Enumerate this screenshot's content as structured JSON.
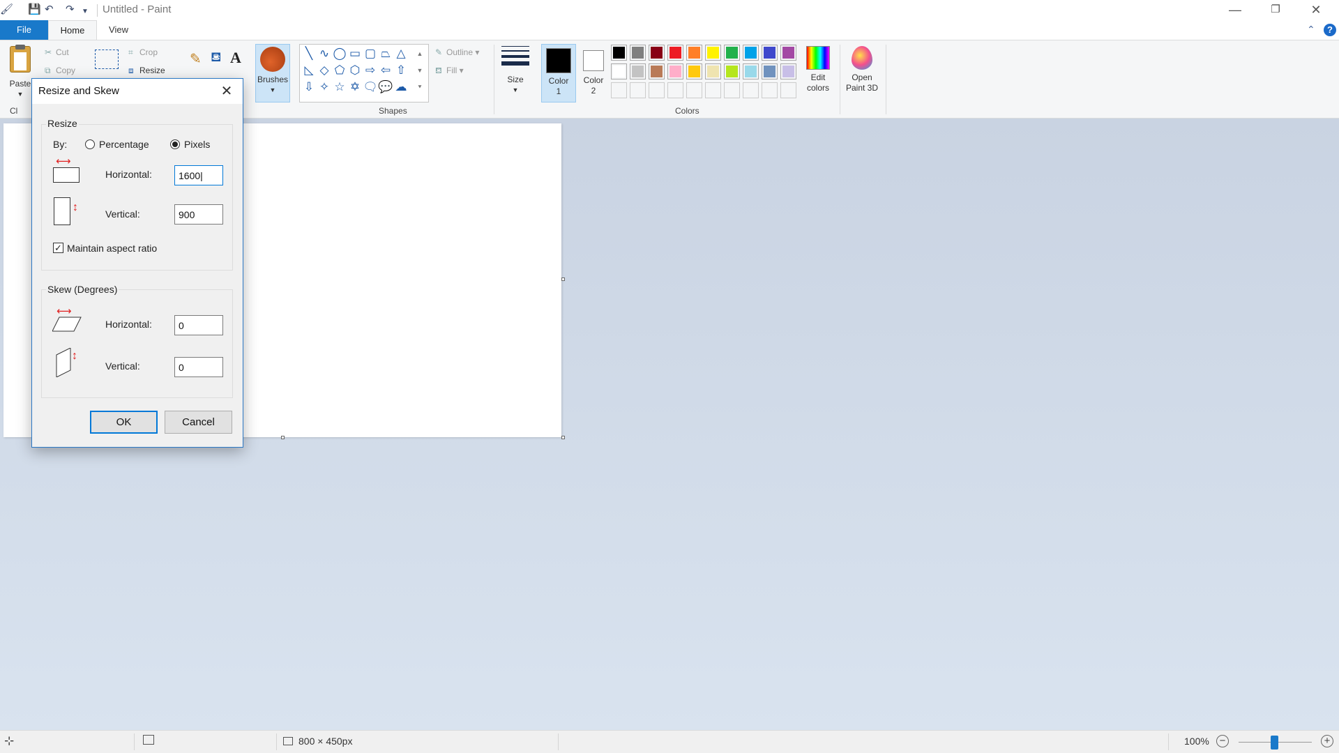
{
  "window": {
    "title": "Untitled - Paint",
    "minimize": "—",
    "maximize": "❐",
    "close": "✕"
  },
  "tabs": {
    "file": "File",
    "home": "Home",
    "view": "View"
  },
  "help": "?",
  "ribbon": {
    "clipboard": {
      "paste": "Paste",
      "cut": "Cut",
      "copy": "Copy",
      "group": "Cl"
    },
    "image": {
      "crop": "Crop",
      "resize": "Resize"
    },
    "brushes": "Brushes",
    "shapes": {
      "outline": "Outline",
      "fill": "Fill",
      "group": "Shapes"
    },
    "size": "Size",
    "color1": {
      "line1": "Color",
      "line2": "1",
      "value": "#000000"
    },
    "color2": {
      "line1": "Color",
      "line2": "2",
      "value": "#ffffff"
    },
    "edit_colors": {
      "line1": "Edit",
      "line2": "colors"
    },
    "open_paint3d": {
      "line1": "Open",
      "line2": "Paint 3D"
    },
    "colors_group": "Colors",
    "palette_row1": [
      "#000000",
      "#7f7f7f",
      "#880015",
      "#ed1c24",
      "#ff7f27",
      "#fff200",
      "#22b14c",
      "#00a2e8",
      "#3f48cc",
      "#a349a4"
    ],
    "palette_row2": [
      "#ffffff",
      "#c3c3c3",
      "#b97a57",
      "#ffaec9",
      "#ffc90e",
      "#efe4b0",
      "#b5e61d",
      "#99d9ea",
      "#7092be",
      "#c8bfe7"
    ]
  },
  "dialog": {
    "title": "Resize and Skew",
    "resize_group": "Resize",
    "by_label": "By:",
    "percentage": "Percentage",
    "pixels": "Pixels",
    "selected_unit": "Pixels",
    "horizontal_label": "Horizontal:",
    "vertical_label": "Vertical:",
    "horizontal_value": "1600",
    "vertical_value": "900",
    "maintain_aspect": "Maintain aspect ratio",
    "maintain_checked": true,
    "skew_group": "Skew (Degrees)",
    "skew_horizontal_label": "Horizontal:",
    "skew_vertical_label": "Vertical:",
    "skew_horizontal_value": "0",
    "skew_vertical_value": "0",
    "ok": "OK",
    "cancel": "Cancel"
  },
  "status": {
    "image_size": "800 × 450px",
    "zoom": "100%",
    "zoom_level": 1.0
  }
}
